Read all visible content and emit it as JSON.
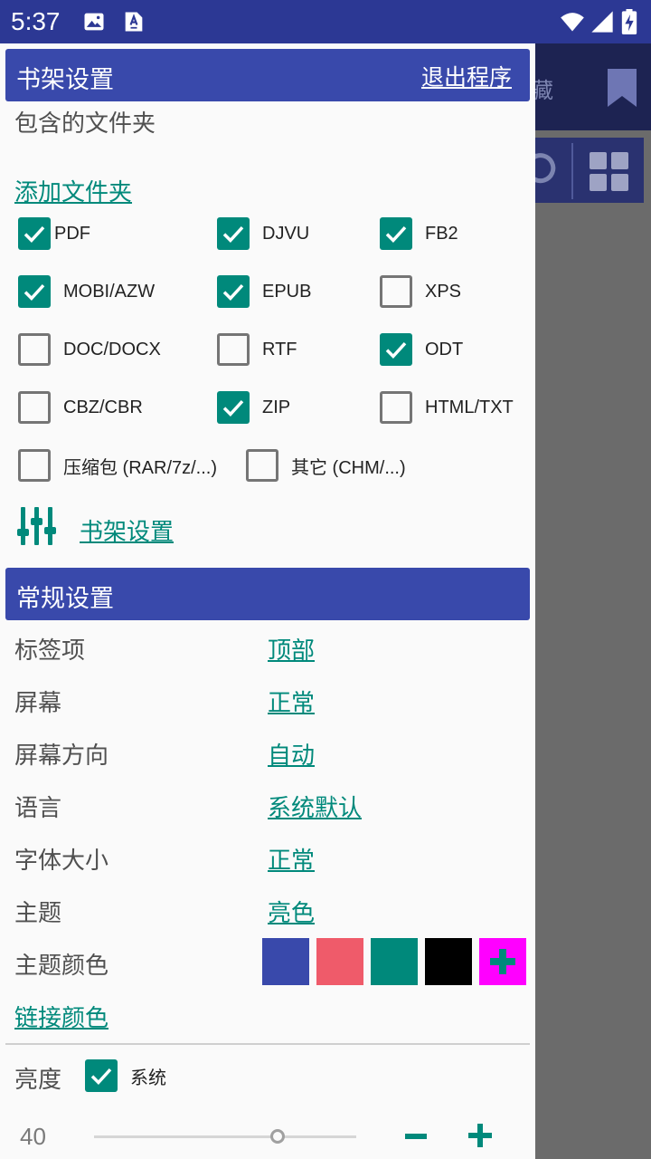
{
  "status_bar": {
    "time": "5:37"
  },
  "background_app": {
    "tab_text": "藏"
  },
  "shelf_settings": {
    "title": "书架设置",
    "exit_label": "退出程序",
    "folders_label": "包含的文件夹",
    "add_folder_link": "添加文件夹",
    "formats": [
      {
        "label": "PDF",
        "checked": true
      },
      {
        "label": "DJVU",
        "checked": true
      },
      {
        "label": "FB2",
        "checked": true
      },
      {
        "label": "MOBI/AZW",
        "checked": true
      },
      {
        "label": "EPUB",
        "checked": true
      },
      {
        "label": "XPS",
        "checked": false
      },
      {
        "label": "DOC/DOCX",
        "checked": false
      },
      {
        "label": "RTF",
        "checked": false
      },
      {
        "label": "ODT",
        "checked": true
      },
      {
        "label": "CBZ/CBR",
        "checked": false
      },
      {
        "label": "ZIP",
        "checked": true
      },
      {
        "label": "HTML/TXT",
        "checked": false
      },
      {
        "label": "压缩包 (RAR/7z/...)",
        "checked": false
      },
      {
        "label": "其它 (CHM/...)",
        "checked": false
      }
    ],
    "shelf_settings_link": "书架设置"
  },
  "general_settings": {
    "title": "常规设置",
    "rows": [
      {
        "label": "标签项",
        "value": "顶部"
      },
      {
        "label": "屏幕",
        "value": "正常"
      },
      {
        "label": "屏幕方向",
        "value": "自动"
      },
      {
        "label": "语言",
        "value": "系统默认"
      },
      {
        "label": "字体大小",
        "value": "正常"
      },
      {
        "label": "主题",
        "value": "亮色"
      }
    ],
    "theme_color_label": "主题颜色",
    "theme_colors": [
      "#3949ab",
      "#ef5b6a",
      "#00897b",
      "#000000"
    ],
    "add_color_swatch": "#ff00ff",
    "link_color_label": "链接颜色",
    "brightness_label": "亮度",
    "brightness_system_label": "系统",
    "brightness_system_checked": true,
    "brightness_value": "40",
    "brightness_slider_level": 0.75
  },
  "colors": {
    "accent": "#00897b",
    "header": "#3949ab",
    "statusbar": "#2c3894"
  }
}
